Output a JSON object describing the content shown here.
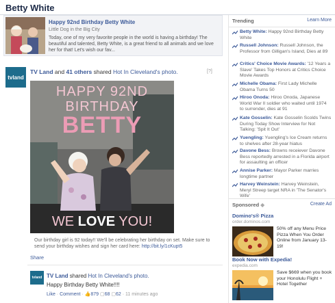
{
  "page": {
    "title": "Betty White"
  },
  "preview": {
    "title": "Happy 92nd Birthday Betty White",
    "subtitle": "Little Dog in the Big City",
    "text": "Today, one of my very favorite people in the world is having a birthday! The beautiful and talented, Betty White, is a great friend to all animals and we love her for that! Let's wish our fav..."
  },
  "post": {
    "avatar_label": "tvland",
    "actor": "TV Land",
    "and": "and",
    "others": "41 others",
    "shared": "shared",
    "source": "Hot In Cleveland's photo.",
    "help": "[?]",
    "photo_text": {
      "line1": "HAPPY 92ND",
      "line2": "BIRTHDAY",
      "line3": "BETTY",
      "we": "WE",
      "love": "LOVE",
      "you": "YOU!"
    },
    "caption": "Our birthday girl is 92 today!! We'll be celebrating her birthday on set. Make sure to send your birthday wishes and sign her card here:",
    "caption_link": "http://bit.ly/1cKupt5",
    "share": "Share"
  },
  "sub_post": {
    "avatar_label": "tvland",
    "actor": "TV Land",
    "shared": "shared",
    "source": "Hot In Cleveland's photo.",
    "message": "Happy Birthday Betty White!!!!",
    "like": "Like",
    "comment": "Comment",
    "likes": "879",
    "comments": "68",
    "shares": "62",
    "time": "11 minutes ago"
  },
  "trending": {
    "heading": "Trending",
    "learn_more": "Learn More",
    "items": [
      {
        "name": "Betty White:",
        "text": "Happy 92nd Birthday Betty White"
      },
      {
        "name": "Russell Johnson:",
        "text": "Russell Johnson, the Professor from Gilligan's Island, Dies at 89"
      },
      {
        "name": "Critics' Choice Movie Awards:",
        "text": "'12 Years a Slave' Takes Top Honors at Critics Choice Movie Awards"
      },
      {
        "name": "Michelle Obama:",
        "text": "First Lady Michelle Obama Turns 50"
      },
      {
        "name": "Hiroo Onoda:",
        "text": "Hiroo Onoda, Japanese World War II soldier who waited until 1974 to surrender, dies at 91"
      },
      {
        "name": "Kate Gosselin:",
        "text": "Kate Gosselin Scolds Twins During Today Show Interview for Not Talking: 'Spit It Out'"
      },
      {
        "name": "Yuengling:",
        "text": "Yuengling's Ice Cream returns to shelves after 28-year hiatus"
      },
      {
        "name": "Davone Bess:",
        "text": "Browns receiever Davone Bess reportedly arrested in a Florida airport for assaulting an officer"
      },
      {
        "name": "Annise Parker:",
        "text": "Mayor Parker marries longtime partner"
      },
      {
        "name": "Harvey Weinstein:",
        "text": "Harvey Weinstein, Meryl Streep target NRA in 'The Senator's Wife'"
      }
    ]
  },
  "sponsored": {
    "heading": "Sponsored",
    "create_ad": "Create Ad",
    "ads": [
      {
        "title": "Domino's® Pizza",
        "domain": "order.dominos.com",
        "text": "50% off any Menu Price Pizza When You Order Online from January 13-19!"
      },
      {
        "title": "Book Now with Expedia!",
        "domain": "expedia.com",
        "text": "Save $669 when you book your Honolulu Flight + Hotel Together"
      }
    ]
  }
}
